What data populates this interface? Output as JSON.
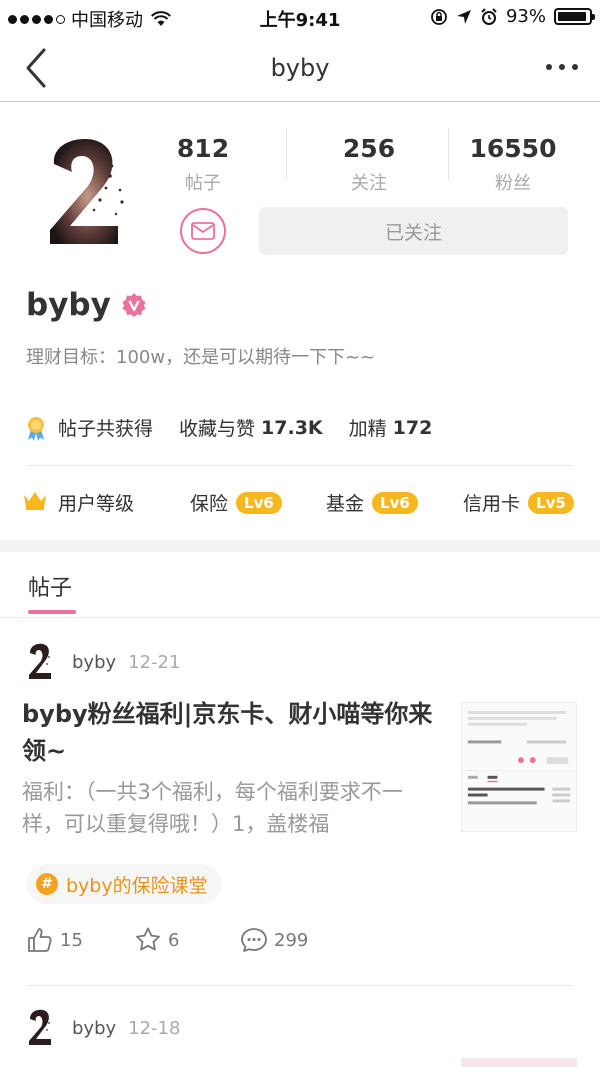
{
  "status_bar": {
    "carrier": "中国移动",
    "time": "上午9:41",
    "battery_percent": "93%",
    "battery_level": 0.93
  },
  "nav": {
    "title": "byby"
  },
  "profile": {
    "stats": [
      {
        "value": "812",
        "label": "帖子"
      },
      {
        "value": "256",
        "label": "关注"
      },
      {
        "value": "16550",
        "label": "粉丝"
      }
    ],
    "follow_label": "已关注",
    "username": "byby",
    "bio": "理财目标：100w，还是可以期待一下下~~",
    "achievements": {
      "label": "帖子共获得",
      "favorites_label": "收藏与赞",
      "favorites_value": "17.3K",
      "featured_label": "加精",
      "featured_value": "172"
    },
    "levels": {
      "title": "用户等级",
      "items": [
        {
          "name": "保险",
          "level": "Lv6"
        },
        {
          "name": "基金",
          "level": "Lv6"
        },
        {
          "name": "信用卡",
          "level": "Lv5"
        }
      ]
    }
  },
  "tabs": [
    {
      "label": "帖子"
    }
  ],
  "posts": [
    {
      "author": "byby",
      "date": "12-21",
      "title": "byby粉丝福利|京东卡、财小喵等你来领~",
      "excerpt": "福利：（一共3个福利，每个福利要求不一样，可以重复得哦！）1，盖楼福",
      "tag": "byby的保险课堂",
      "likes": "15",
      "stars": "6",
      "comments": "299"
    },
    {
      "author": "byby",
      "date": "12-18"
    }
  ],
  "colors": {
    "accent_pink": "#e9739a",
    "badge_orange": "#f6b81e",
    "tag_orange": "#e8941a"
  }
}
